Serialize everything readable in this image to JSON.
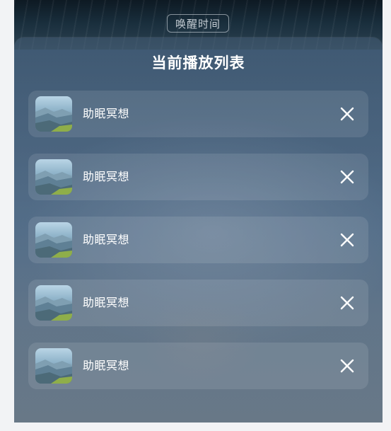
{
  "header": {
    "wake_time_label": "唤醒时间"
  },
  "playlist": {
    "title": "当前播放列表",
    "items": [
      {
        "label": "助眠冥想",
        "thumb_icon": "landscape-thumbnail",
        "action_icon": "close-icon"
      },
      {
        "label": "助眠冥想",
        "thumb_icon": "landscape-thumbnail",
        "action_icon": "close-icon"
      },
      {
        "label": "助眠冥想",
        "thumb_icon": "landscape-thumbnail",
        "action_icon": "close-icon"
      },
      {
        "label": "助眠冥想",
        "thumb_icon": "landscape-thumbnail",
        "action_icon": "close-icon"
      },
      {
        "label": "助眠冥想",
        "thumb_icon": "landscape-thumbnail",
        "action_icon": "close-icon"
      }
    ]
  }
}
